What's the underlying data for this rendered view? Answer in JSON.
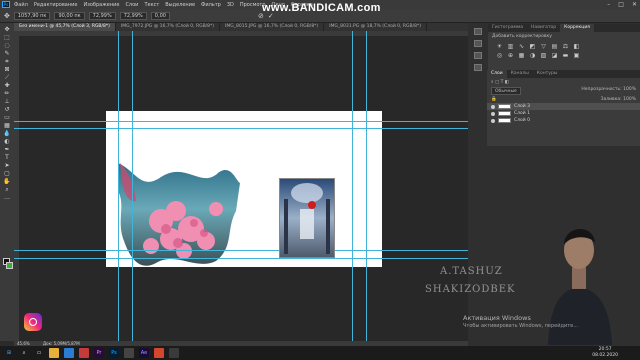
{
  "app": {
    "logo": "Ps"
  },
  "menubar": {
    "items": [
      "Файл",
      "Редактирование",
      "Изображение",
      "Слои",
      "Текст",
      "Выделение",
      "Фильтр",
      "3D",
      "Просмотр",
      "Окно",
      "Справка"
    ]
  },
  "watermark": "www.BANDICAM.com",
  "options_bar": {
    "values": [
      "1057,90 пк",
      "90,00 пк",
      "72,99%",
      "72,99%",
      "0,00"
    ]
  },
  "doc_tabs": [
    {
      "label": "Без имени-1 @ 45,7% (Слой 3, RGB/8*)",
      "active": true
    },
    {
      "label": "IMG_7972.JPG @ 16,7% (Слой 0, RGB/8*)",
      "active": false
    },
    {
      "label": "IMG_8015.JPG @ 16,7% (Слой 0, RGB/8*)",
      "active": false
    },
    {
      "label": "IMG_8031.PG @ 18,7% (Слой 0, RGB/8*)",
      "active": false
    }
  ],
  "status": {
    "zoom": "45,6%",
    "doc": "Док: 5,09M/5,87M"
  },
  "right_panel": {
    "top_tabs": [
      "Гистограмма",
      "Навигатор",
      "Коррекция"
    ],
    "top_subtitle": "Добавить корректировку",
    "layers_tabs": [
      "Слои",
      "Каналы",
      "Контуры"
    ],
    "blend_mode": "Обычные",
    "opacity_label": "Непрозрачность:",
    "opacity": "100%",
    "fill_label": "Заливка:",
    "fill": "100%",
    "layers": [
      {
        "name": "Слой 3",
        "selected": true
      },
      {
        "name": "Слой 1",
        "selected": false
      },
      {
        "name": "Слой 0",
        "selected": false
      }
    ]
  },
  "overlay": {
    "line1": "A.TASHUZ",
    "line2": "SHAKIZODBEK",
    "activation_title": "Активация Windows",
    "activation_sub": "Чтобы активировать Windows, перейдите..."
  },
  "taskbar": {
    "time": "20:57",
    "date": "08.02.2020"
  }
}
